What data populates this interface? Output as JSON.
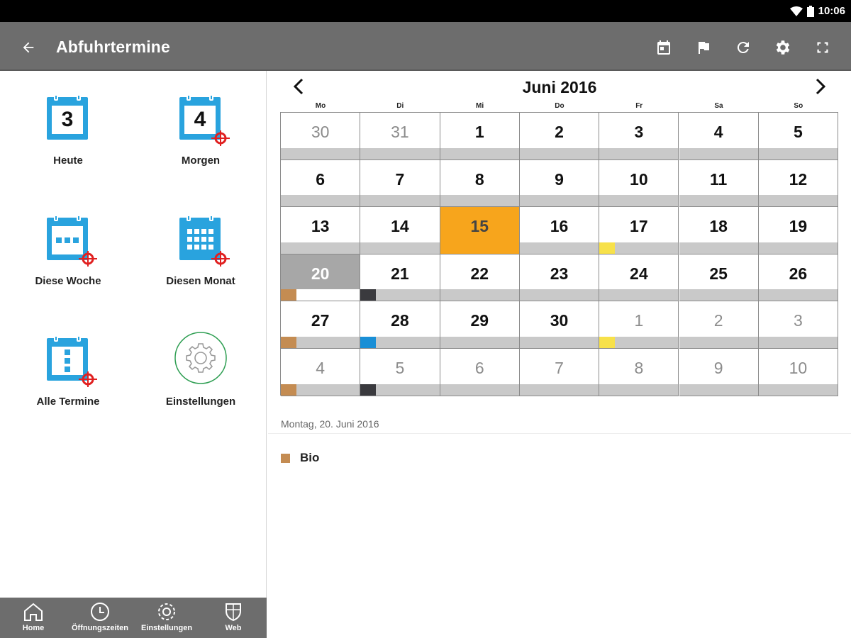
{
  "status": {
    "time": "10:06"
  },
  "appbar": {
    "title": "Abfuhrtermine",
    "actions": [
      "calendar-today-icon",
      "flag-icon",
      "refresh-icon",
      "settings-icon",
      "fullscreen-icon"
    ]
  },
  "tiles": [
    {
      "label": "Heute",
      "icon": "calendar-day-icon",
      "number": "3"
    },
    {
      "label": "Morgen",
      "icon": "calendar-day-icon",
      "number": "4"
    },
    {
      "label": "Diese Woche",
      "icon": "calendar-week-icon"
    },
    {
      "label": "Diesen Monat",
      "icon": "calendar-month-icon"
    },
    {
      "label": "Alle Termine",
      "icon": "calendar-list-icon"
    },
    {
      "label": "Einstellungen",
      "icon": "gear-icon"
    }
  ],
  "bottom_nav": [
    {
      "label": "Home",
      "icon": "home-icon"
    },
    {
      "label": "Öffnungszeiten",
      "icon": "clock-icon"
    },
    {
      "label": "Einstellungen",
      "icon": "gear-icon"
    },
    {
      "label": "Web",
      "icon": "shield-icon"
    }
  ],
  "calendar": {
    "title": "Juni 2016",
    "weekdays": [
      "Mo",
      "Di",
      "Mi",
      "Do",
      "Fr",
      "Sa",
      "So"
    ],
    "weeks": [
      [
        {
          "d": "30",
          "o": true
        },
        {
          "d": "31",
          "o": true
        },
        {
          "d": "1"
        },
        {
          "d": "2"
        },
        {
          "d": "3"
        },
        {
          "d": "4"
        },
        {
          "d": "5"
        }
      ],
      [
        {
          "d": "6"
        },
        {
          "d": "7"
        },
        {
          "d": "8"
        },
        {
          "d": "9"
        },
        {
          "d": "10"
        },
        {
          "d": "11"
        },
        {
          "d": "12"
        }
      ],
      [
        {
          "d": "13"
        },
        {
          "d": "14"
        },
        {
          "d": "15",
          "today": true
        },
        {
          "d": "16"
        },
        {
          "d": "17",
          "chip": "#f7e14a"
        },
        {
          "d": "18"
        },
        {
          "d": "19"
        }
      ],
      [
        {
          "d": "20",
          "selected": true,
          "chip": "#c48c52"
        },
        {
          "d": "21",
          "chip": "#3a3a3e"
        },
        {
          "d": "22"
        },
        {
          "d": "23"
        },
        {
          "d": "24"
        },
        {
          "d": "25"
        },
        {
          "d": "26"
        }
      ],
      [
        {
          "d": "27",
          "chip": "#c48c52"
        },
        {
          "d": "28",
          "chip": "#1a8fd6"
        },
        {
          "d": "29"
        },
        {
          "d": "30"
        },
        {
          "d": "1",
          "o": true,
          "chip": "#f7e14a"
        },
        {
          "d": "2",
          "o": true
        },
        {
          "d": "3",
          "o": true
        }
      ],
      [
        {
          "d": "4",
          "o": true,
          "chip": "#c48c52"
        },
        {
          "d": "5",
          "o": true,
          "chip": "#3a3a3e"
        },
        {
          "d": "6",
          "o": true
        },
        {
          "d": "7",
          "o": true
        },
        {
          "d": "8",
          "o": true
        },
        {
          "d": "9",
          "o": true
        },
        {
          "d": "10",
          "o": true
        }
      ]
    ]
  },
  "detail": {
    "date": "Montag, 20. Juni 2016",
    "events": [
      {
        "label": "Bio",
        "color": "#c48c52"
      }
    ]
  },
  "colors": {
    "appbar": "#6d6d6d",
    "accent_blue": "#29a3de",
    "today": "#f7a51c",
    "selected": "#a7a7a7"
  }
}
